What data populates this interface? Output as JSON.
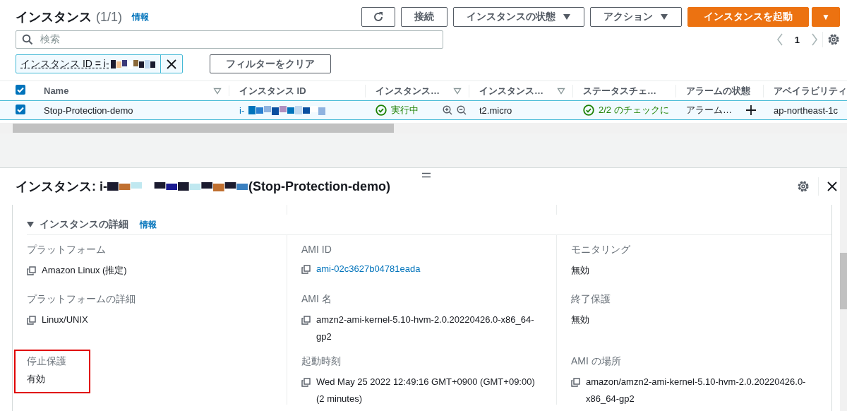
{
  "header": {
    "title": "インスタンス",
    "count": "(1/1)",
    "info": "情報"
  },
  "toolbar": {
    "buttons": [
      {
        "kind": "refresh"
      },
      {
        "kind": "plain",
        "label": "接続"
      },
      {
        "kind": "dropdown",
        "label": "インスタンスの状態"
      },
      {
        "kind": "dropdown",
        "label": "アクション"
      },
      {
        "kind": "primary",
        "label": "インスタンスを起動"
      },
      {
        "kind": "primary-caret",
        "label": "▼"
      }
    ]
  },
  "search": {
    "placeholder": "検索"
  },
  "pagination": {
    "page": "1"
  },
  "filter": {
    "token": "インスタンス ID = i-",
    "clear": "フィルターをクリア"
  },
  "table": {
    "all_selected": true,
    "columns": [
      {
        "label": "Name",
        "sortable": true
      },
      {
        "label": "インスタンス ID",
        "sortable": false
      },
      {
        "label": "インスタンス…",
        "sortable": true
      },
      {
        "label": "インスタンス…",
        "sortable": true
      },
      {
        "label": "ステータスチェ…",
        "sortable": false
      },
      {
        "label": "アラームの状態",
        "sortable": false
      },
      {
        "label": "アベイラビリティ"
      }
    ],
    "rows": [
      {
        "selected": true,
        "name": "Stop-Protection-demo",
        "instance_id": "i-",
        "state": "実行中",
        "type": "t2.micro",
        "status_check": "2/2 のチェックに",
        "alarm": "アラーム…",
        "zone": "ap-northeast-1c"
      }
    ]
  },
  "detail": {
    "title": "インスタンス: i-",
    "title_suffix": "(Stop-Protection-demo)",
    "section": {
      "title": "インスタンスの詳細",
      "info": "情報",
      "expanded": true
    },
    "columns": [
      [
        {
          "label": "プラットフォーム",
          "value": "Amazon Linux (推定)",
          "kind": "text",
          "copy": true,
          "highlighted": false
        },
        {
          "label": "プラットフォームの詳細",
          "value": "Linux/UNIX",
          "kind": "text",
          "copy": true,
          "highlighted": false
        },
        {
          "label": "停止保護",
          "value": "有効",
          "kind": "text",
          "copy": false,
          "highlighted": true
        }
      ],
      [
        {
          "label": "AMI ID",
          "value": "ami-02c3627b04781eada",
          "kind": "link",
          "copy": true,
          "highlighted": false
        },
        {
          "label": "AMI 名",
          "value": "amzn2-ami-kernel-5.10-hvm-2.0.20220426.0-x86_64-gp2",
          "kind": "text",
          "copy": true,
          "highlighted": false
        },
        {
          "label": "起動時刻",
          "value": "Wed May 25 2022 12:49:16 GMT+0900 (GMT+09:00) (2 minutes)",
          "kind": "text",
          "copy": true,
          "highlighted": false
        }
      ],
      [
        {
          "label": "モニタリング",
          "value": "無効",
          "kind": "text",
          "copy": false,
          "highlighted": false
        },
        {
          "label": "終了保護",
          "value": "無効",
          "kind": "text",
          "copy": false,
          "highlighted": false
        },
        {
          "label": "AMI の場所",
          "value": "amazon/amzn2-ami-kernel-5.10-hvm-2.0.20220426.0-x86_64-gp2",
          "kind": "text",
          "copy": true,
          "highlighted": false
        }
      ]
    ]
  }
}
